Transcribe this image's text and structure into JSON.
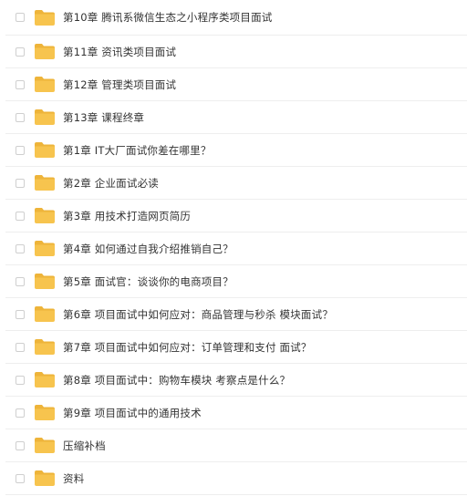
{
  "colors": {
    "folder": "#f7c44e",
    "folder_tab": "#eeb43a",
    "text": "#333333",
    "divider": "#eeeeee",
    "checkbox_border": "#cfcfcf"
  },
  "icons": {
    "item": "folder-icon",
    "select": "checkbox"
  },
  "files": [
    {
      "name": "第10章 腾讯系微信生态之小程序类项目面试"
    },
    {
      "name": "第11章 资讯类项目面试"
    },
    {
      "name": "第12章 管理类项目面试"
    },
    {
      "name": "第13章 课程终章"
    },
    {
      "name": "第1章 IT大厂面试你差在哪里？"
    },
    {
      "name": "第2章 企业面试必读"
    },
    {
      "name": "第3章 用技术打造网页简历"
    },
    {
      "name": "第4章 如何通过自我介绍推销自己？"
    },
    {
      "name": "第5章 面试官：谈谈你的电商项目？"
    },
    {
      "name": "第6章 项目面试中如何应对：商品管理与秒杀 模块面试？"
    },
    {
      "name": "第7章 项目面试中如何应对：订单管理和支付 面试？"
    },
    {
      "name": "第8章 项目面试中：购物车模块 考察点是什么？"
    },
    {
      "name": "第9章 项目面试中的通用技术"
    },
    {
      "name": "压缩补档"
    },
    {
      "name": "资料"
    }
  ]
}
